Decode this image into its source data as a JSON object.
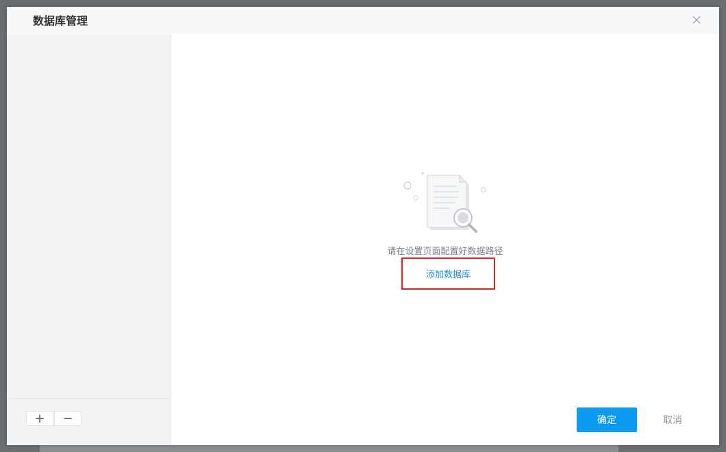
{
  "dialog": {
    "title": "数据库管理",
    "close_icon": "close-icon"
  },
  "sidebar": {
    "add_label": "+",
    "remove_label": "−",
    "add_icon": "plus-icon",
    "remove_icon": "minus-icon"
  },
  "main": {
    "empty_icon": "document-search-icon",
    "empty_message": "请在设置页面配置好数据路径",
    "add_database_link": "添加数据库"
  },
  "footer": {
    "confirm_label": "确定",
    "cancel_label": "取消"
  },
  "colors": {
    "accent": "#0d9bf2",
    "link": "#1e8fd8",
    "highlight_border": "#e02128"
  }
}
